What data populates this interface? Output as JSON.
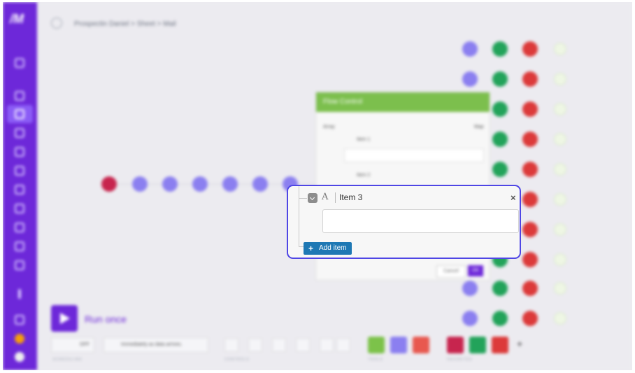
{
  "app": {
    "logo": "/M"
  },
  "breadcrumb": "Prospectin Daniel > Sheet > Mail",
  "dialog": {
    "title": "Flow Control",
    "array_label": "Array",
    "map_label": "Map",
    "item1": "Item 1",
    "item2": "Item 2",
    "cancel": "Cancel",
    "ok": "OK"
  },
  "focused_item": {
    "type_icon": "A",
    "label": "Item 3",
    "input_value": "",
    "close": "×"
  },
  "add_item": {
    "plus": "+",
    "label": "Add item"
  },
  "toolbar": {
    "run_once": "Run once",
    "schedule_toggle": "OFF",
    "schedule_text": "Immediately as data arrives.",
    "scheduling_caption": "SCHEDULING",
    "controls_caption": "CONTROLS",
    "tools_caption": "TOOLS",
    "favorites_caption": "FAVORITES",
    "add": "+"
  },
  "colors": {
    "accent": "#6d28d9",
    "focus_border": "#4f46e5",
    "add_button": "#1e78b4",
    "dialog_header": "#7cbf4d"
  }
}
